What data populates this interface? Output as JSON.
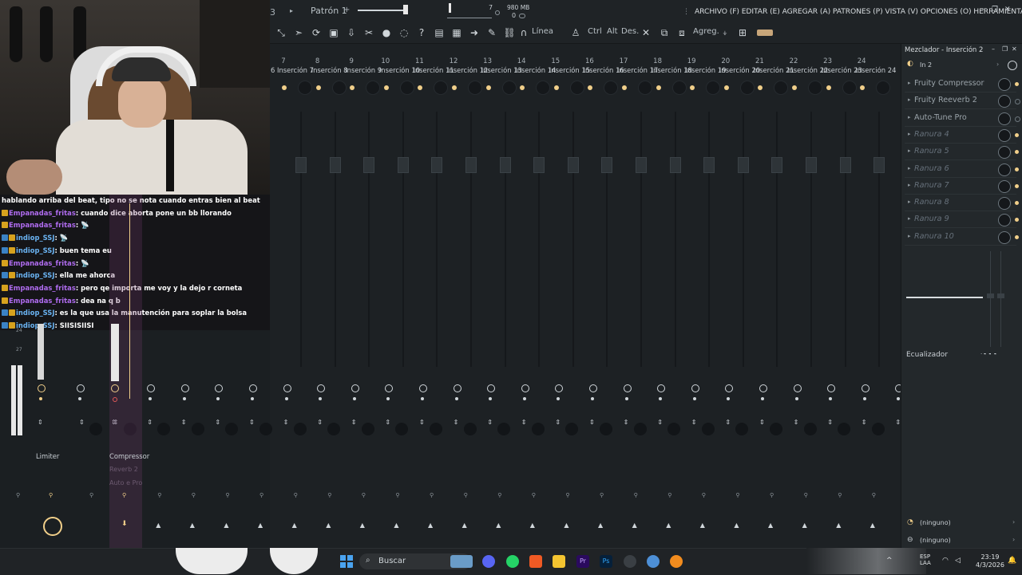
{
  "topbar": {
    "pattern_label": "Patrón 1",
    "pattern_plus": "+",
    "corner_label": "3",
    "number_seven": "7",
    "memory": "980 MB",
    "zero": "0",
    "menu": "ARCHIVO (F) EDITAR (E) AGREGAR (A) PATRONES (P) VISTA (V) OPCIONES (O) HERRAMIENTAS (T) AYUDA"
  },
  "toolbar": {
    "linea": "Línea",
    "ctrl": "Ctrl",
    "alt": "Alt",
    "des": "Des.",
    "agreg": "Agreg."
  },
  "chat": [
    {
      "user": "",
      "badges": [],
      "text": "hablando arriba del beat, tipo no se nota cuando entras bien al beat",
      "color": ""
    },
    {
      "user": "Empanadas_fritas",
      "badges": [
        "gold"
      ],
      "text": ": cuando dice aborta pone un bb llorando",
      "color": "purple"
    },
    {
      "user": "Empanadas_fritas",
      "badges": [
        "gold"
      ],
      "text": ": 📡",
      "color": "purple"
    },
    {
      "user": "indiop_SSJ",
      "badges": [
        "mod",
        "gold"
      ],
      "text": ": 📡",
      "color": "blue"
    },
    {
      "user": "indiop_SSJ",
      "badges": [
        "mod",
        "gold"
      ],
      "text": ": buen tema eu",
      "color": "blue"
    },
    {
      "user": "Empanadas_fritas",
      "badges": [
        "gold"
      ],
      "text": ": 📡",
      "color": "purple"
    },
    {
      "user": "indiop_SSJ",
      "badges": [
        "mod",
        "gold"
      ],
      "text": ": ella me ahorca",
      "color": "blue"
    },
    {
      "user": "Empanadas_fritas",
      "badges": [
        "gold"
      ],
      "text": ": pero qe importa me voy y la dejo r corneta",
      "color": "purple"
    },
    {
      "user": "Empanadas_fritas",
      "badges": [
        "gold"
      ],
      "text": ": dea na q b",
      "color": "purple"
    },
    {
      "user": "indiop_SSJ",
      "badges": [
        "mod",
        "gold"
      ],
      "text": ": es la que usa la manutención para soplar la bolsa",
      "color": "blue"
    },
    {
      "user": "indiop_SSJ",
      "badges": [
        "mod",
        "gold"
      ],
      "text": ": SIISISIISI",
      "color": "blue"
    }
  ],
  "mixer": {
    "partial_first_label": "6",
    "inserts": [
      {
        "num": "7",
        "name": "Inserción 7"
      },
      {
        "num": "8",
        "name": "Inserción 8"
      },
      {
        "num": "9",
        "name": "Inserción 9"
      },
      {
        "num": "10",
        "name": "Inserción 10"
      },
      {
        "num": "11",
        "name": "Inserción 11"
      },
      {
        "num": "12",
        "name": "Inserción 12"
      },
      {
        "num": "13",
        "name": "Inserción 13"
      },
      {
        "num": "14",
        "name": "Inserción 14"
      },
      {
        "num": "15",
        "name": "Inserción 15"
      },
      {
        "num": "16",
        "name": "Inserción 16"
      },
      {
        "num": "17",
        "name": "Inserción 17"
      },
      {
        "num": "18",
        "name": "Inserción 18"
      },
      {
        "num": "19",
        "name": "Inserción 19"
      },
      {
        "num": "20",
        "name": "Inserción 20"
      },
      {
        "num": "21",
        "name": "Inserción 21"
      },
      {
        "num": "22",
        "name": "Inserción 22"
      },
      {
        "num": "23",
        "name": "Inserción 23"
      },
      {
        "num": "24",
        "name": "Inserción 24"
      }
    ],
    "left_labels": {
      "limiter": "Limiter",
      "compressor": "Compressor",
      "reverb": "Reverb 2",
      "autotune": "Auto  e Pro",
      "scale_24": "24",
      "scale_27": "27"
    }
  },
  "panel": {
    "title": "Mezclador - Inserción 2",
    "input": "In 2",
    "slots": [
      {
        "name": "Fruity Compressor",
        "empty": false,
        "led": true
      },
      {
        "name": "Fruity Reeverb 2",
        "empty": false,
        "led": false
      },
      {
        "name": "Auto-Tune Pro",
        "empty": false,
        "led": false
      },
      {
        "name": "Ranura 4",
        "empty": true,
        "led": true
      },
      {
        "name": "Ranura 5",
        "empty": true,
        "led": true
      },
      {
        "name": "Ranura 6",
        "empty": true,
        "led": true
      },
      {
        "name": "Ranura 7",
        "empty": true,
        "led": true
      },
      {
        "name": "Ranura 8",
        "empty": true,
        "led": true
      },
      {
        "name": "Ranura 9",
        "empty": true,
        "led": true
      },
      {
        "name": "Ranura 10",
        "empty": true,
        "led": true
      }
    ],
    "eq_label": "Ecualizador",
    "routing1": "(ninguno)",
    "routing2": "(ninguno)"
  },
  "taskbar": {
    "search": "Buscar",
    "lang_top": "ESP",
    "lang_bottom": "LAA",
    "time": "23:19",
    "date": "4/3/2026"
  },
  "colors": {
    "accent": "#f1cf8a",
    "background": "#1c2023",
    "panel": "#23282b"
  }
}
